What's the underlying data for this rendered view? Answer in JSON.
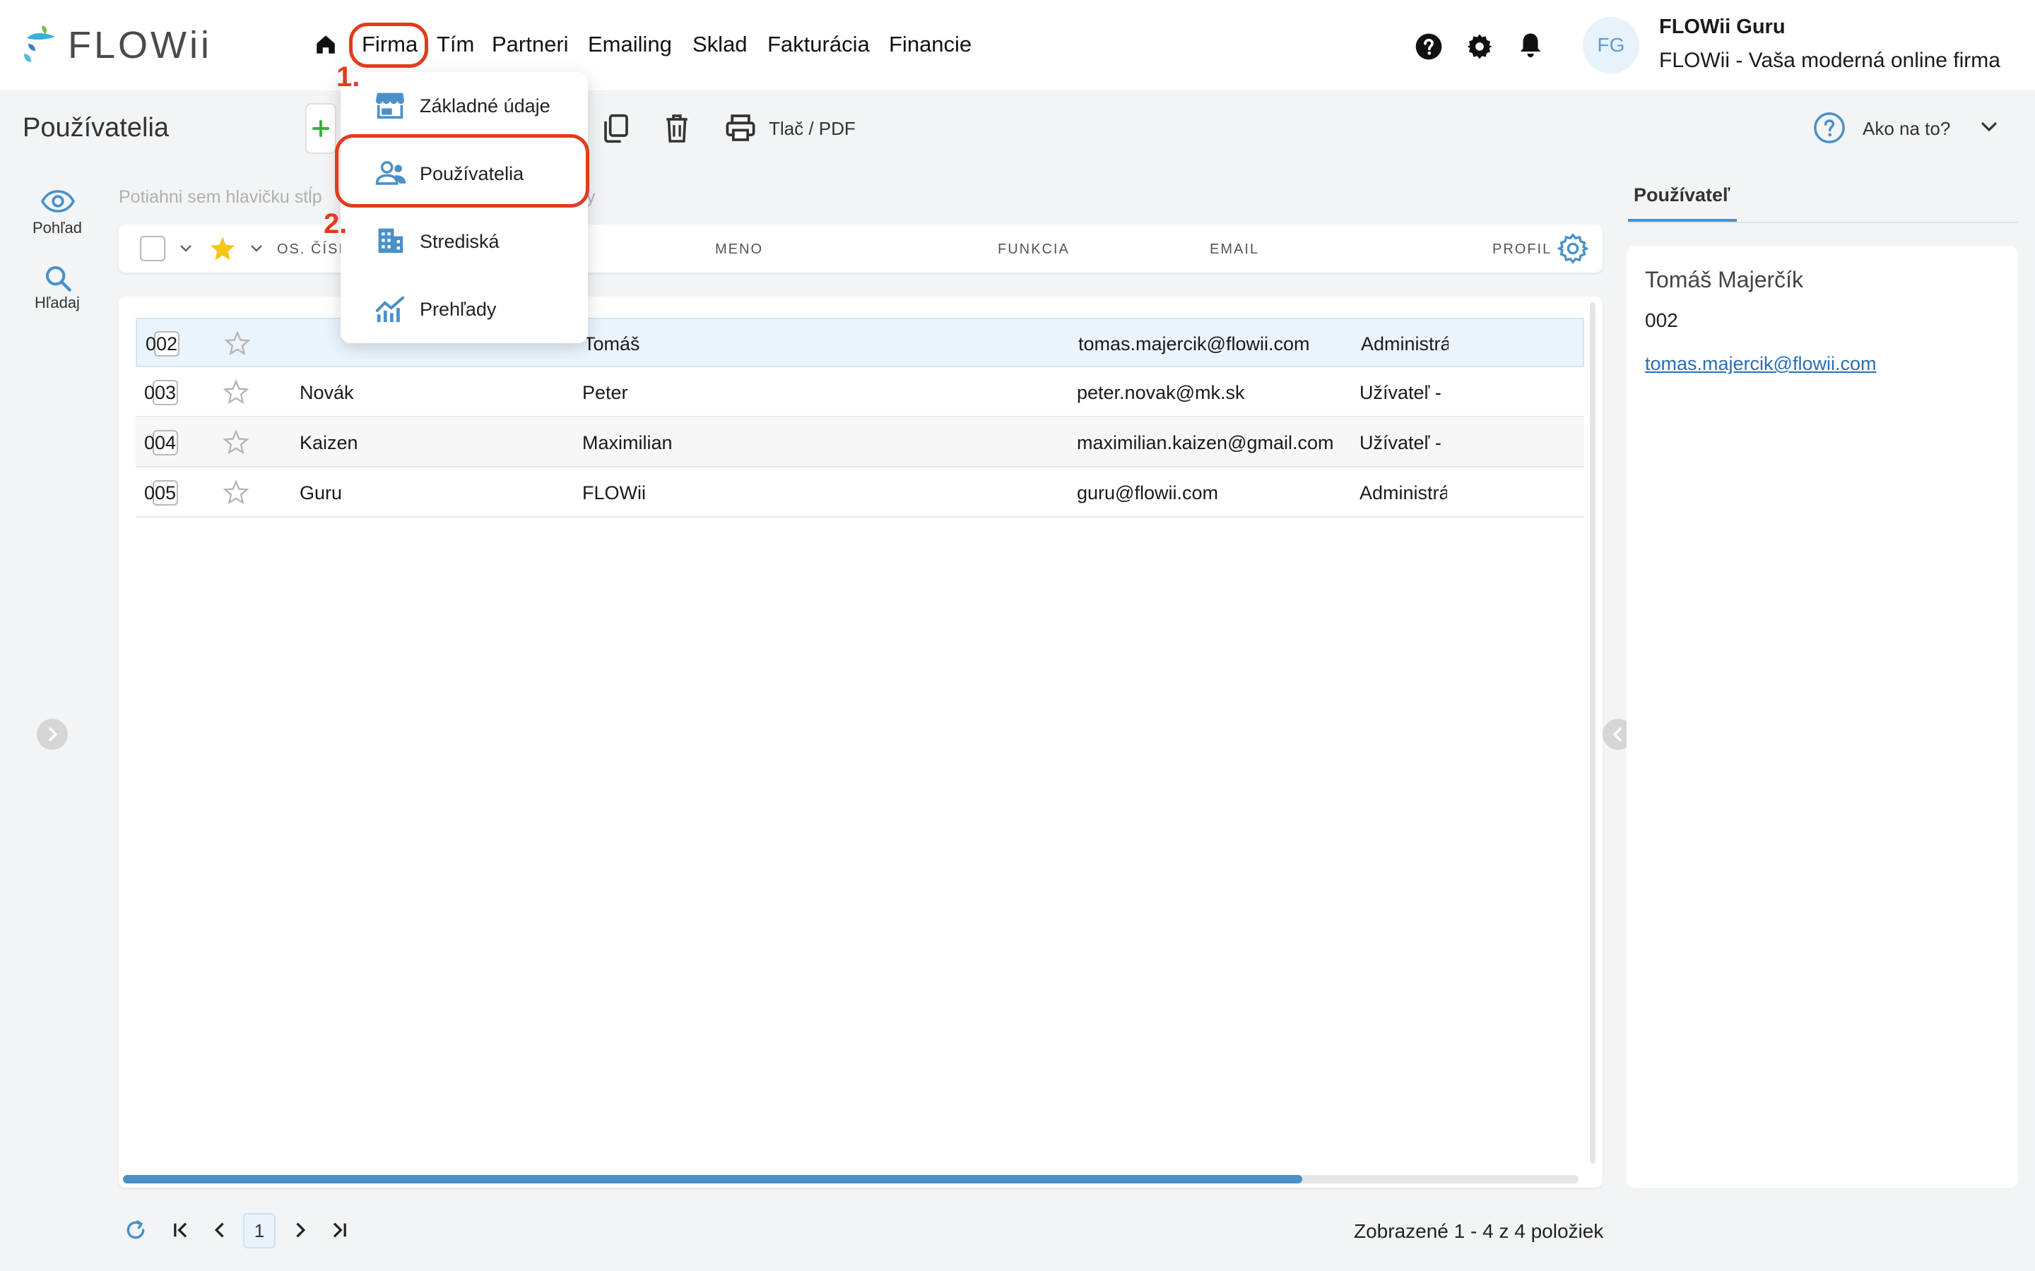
{
  "app": {
    "logo": "FLOWii",
    "nav": [
      "Firma",
      "Tím",
      "Partneri",
      "Emailing",
      "Sklad",
      "Fakturácia",
      "Financie"
    ],
    "user": {
      "initials": "FG",
      "name": "FLOWii Guru",
      "company": "FLOWii - Vaša moderná online firma"
    }
  },
  "toolbar": {
    "page_title": "Používatelia",
    "print_label": "Tlač / PDF",
    "help_label": "Ako na to?"
  },
  "sidebar": {
    "view_label": "Pohľad",
    "search_label": "Hľadaj"
  },
  "grid": {
    "drag_hint": "Potiahni sem hlavičku stĺp",
    "drag_hint_end": "y",
    "columns": [
      "OS. ČÍSI",
      "MENO",
      "FUNKCIA",
      "EMAIL",
      "PROFIL"
    ],
    "rows": [
      {
        "num": "002",
        "surname": "",
        "name": "Tomáš",
        "function": "",
        "email": "tomas.majercik@flowii.com",
        "profile": "Administrá"
      },
      {
        "num": "003",
        "surname": "Novák",
        "name": "Peter",
        "function": "",
        "email": "peter.novak@mk.sk",
        "profile": "Užívateľ - ."
      },
      {
        "num": "004",
        "surname": "Kaizen",
        "name": "Maximilian",
        "function": "",
        "email": "maximilian.kaizen@gmail.com",
        "profile": "Užívateľ -"
      },
      {
        "num": "005",
        "surname": "Guru",
        "name": "FLOWii",
        "function": "",
        "email": "guru@flowii.com",
        "profile": "Administrá"
      }
    ],
    "selected_row": 0
  },
  "pagination": {
    "page": "1",
    "info": "Zobrazené 1 - 4 z 4 položiek",
    "scroll_fraction": 0.81
  },
  "detail": {
    "tab": "Používateľ",
    "name": "Tomáš Majerčík",
    "number": "002",
    "email": "tomas.majercik@flowii.com"
  },
  "dropdown": {
    "items": [
      "Základné údaje",
      "Používatelia",
      "Strediská",
      "Prehľady"
    ]
  },
  "annotations": {
    "step1": "1.",
    "step2": "2."
  },
  "colors": {
    "accent": "#4a90c9",
    "annotation": "#e23b1e",
    "star": "#f5c518",
    "add": "#3cb043",
    "selected_row": "#eaf4fd"
  }
}
